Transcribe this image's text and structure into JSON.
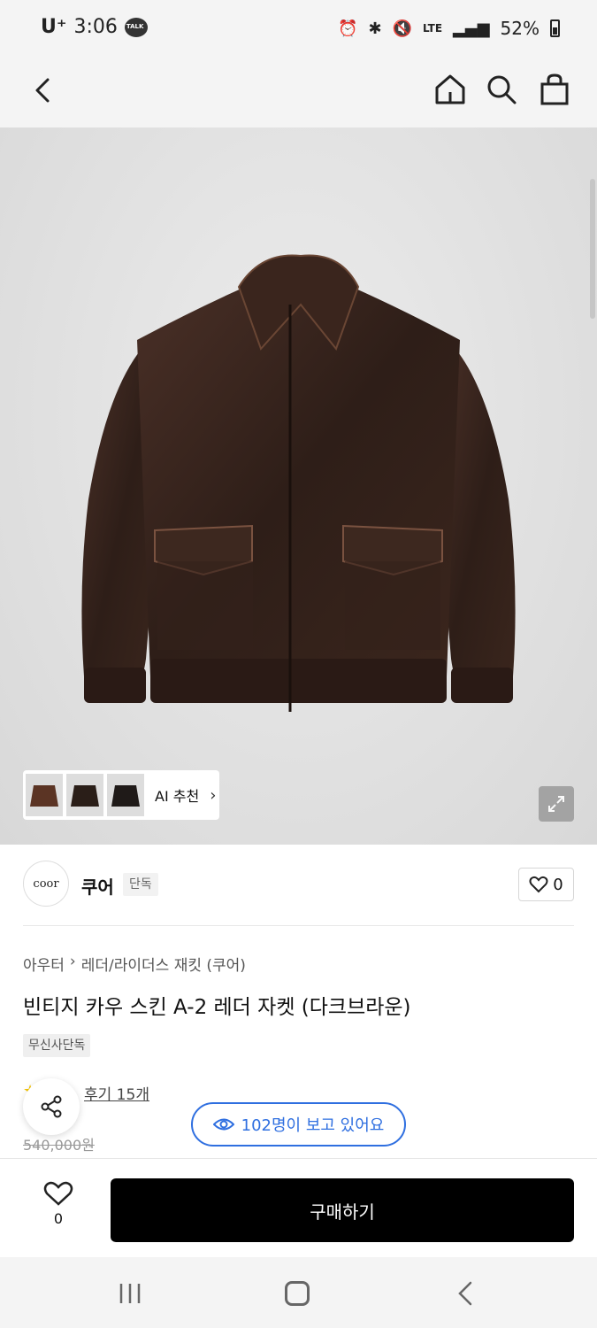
{
  "status_bar": {
    "carrier": "U⁺",
    "time": "3:06",
    "talk": "TALK",
    "network": "LTE",
    "battery": "52%"
  },
  "product": {
    "ai_label": "AI 추천",
    "brand": {
      "logo_text": "coor",
      "name": "쿠어",
      "badge": "단독",
      "likes": "0"
    },
    "breadcrumb": [
      "아우터",
      "레더/라이더스 재킷 (쿠어)"
    ],
    "title": "빈티지 카우 스킨 A-2 레더 자켓 (다크브라운)",
    "tag": "무신사단독",
    "review_link": "후기 15개",
    "old_price": "540,000원",
    "viewers": "102명이 보고 있어요"
  },
  "action_bar": {
    "wish_count": "0",
    "buy_label": "구매하기"
  }
}
